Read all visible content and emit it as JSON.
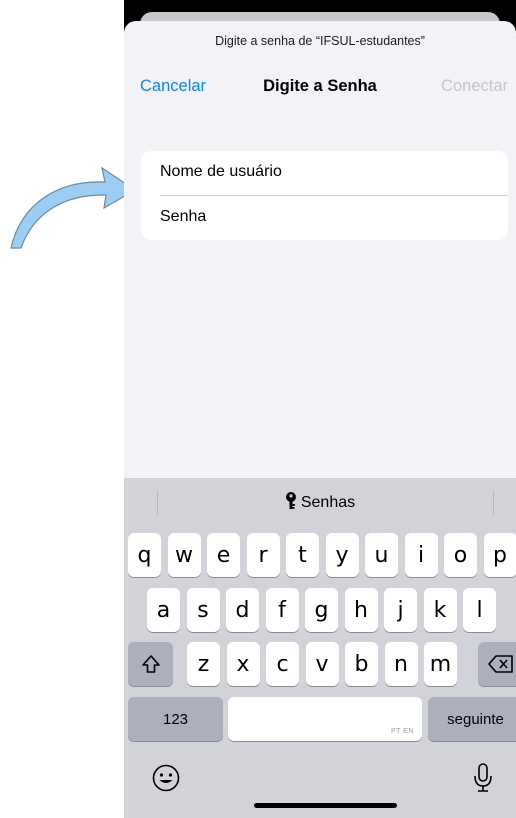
{
  "dialog": {
    "prompt": "Digite a senha de “IFSUL-estudantes”",
    "cancel_label": "Cancelar",
    "title": "Digite a Senha",
    "connect_label": "Conectar"
  },
  "form": {
    "username_placeholder": "Nome de usuário",
    "password_placeholder": "Senha"
  },
  "keyboard": {
    "suggestion_label": "Senhas",
    "row1": [
      "q",
      "w",
      "e",
      "r",
      "t",
      "y",
      "u",
      "i",
      "o",
      "p"
    ],
    "row2": [
      "a",
      "s",
      "d",
      "f",
      "g",
      "h",
      "j",
      "k",
      "l"
    ],
    "row3": [
      "z",
      "x",
      "c",
      "v",
      "b",
      "n",
      "m"
    ],
    "numbers_label": "123",
    "space_hint": "PT EN",
    "return_label": "seguinte"
  },
  "icons": {
    "shift": "shift-icon",
    "backspace": "backspace-icon",
    "emoji": "emoji-icon",
    "mic": "microphone-icon",
    "key": "key-icon",
    "arrow": "curved-arrow-icon"
  },
  "colors": {
    "accent": "#0a84ff",
    "disabled": "#c5c5ca",
    "keyboard_bg": "#d1d3d9",
    "arrow_fill": "#9ccdf2"
  }
}
